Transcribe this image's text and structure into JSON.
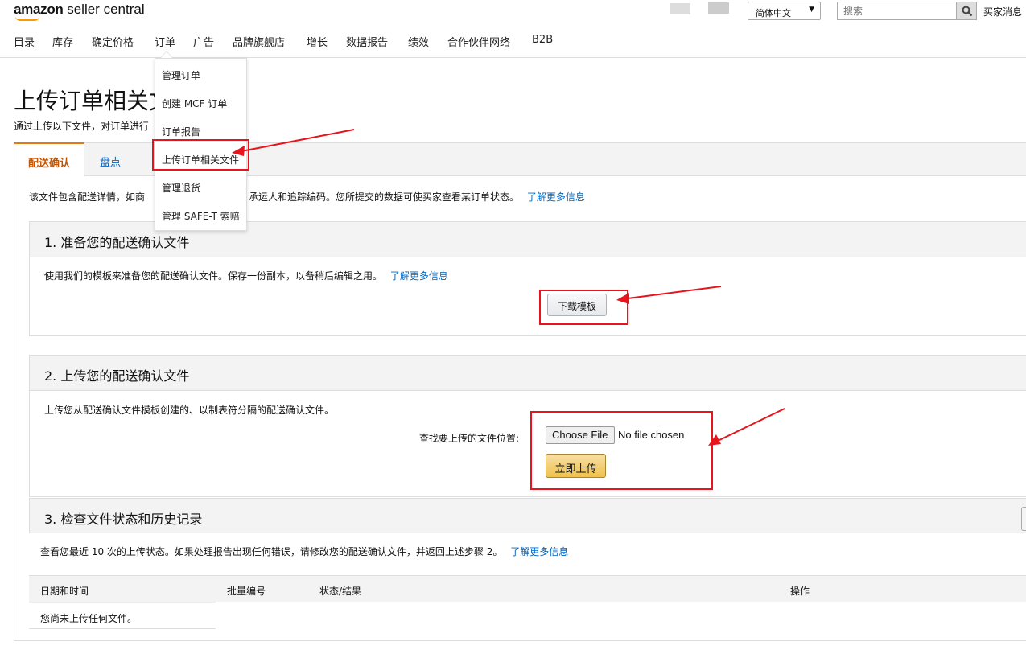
{
  "header": {
    "logo_bold": "amazon",
    "logo_light": " seller central",
    "language": "简体中文",
    "search_placeholder": "搜索",
    "buyer_messages": "买家消息 |"
  },
  "nav": {
    "items": [
      "目录",
      "库存",
      "确定价格",
      "订单",
      "广告",
      "品牌旗舰店",
      "增长",
      "数据报告",
      "绩效",
      "合作伙伴网络",
      "B2B"
    ]
  },
  "dropdown": {
    "items": [
      "管理订单",
      "创建 MCF 订单",
      "订单报告",
      "上传订单相关文件",
      "管理退货",
      "管理 SAFE-T 索赔"
    ]
  },
  "page": {
    "title": "上传订单相关文件",
    "subtitle": "通过上传以下文件，对订单进行"
  },
  "tabs": {
    "items": [
      "配送确认",
      "盘点"
    ]
  },
  "description": {
    "pre": "该文件包含配送详情，如商",
    "post": "承运人和追踪编码。您所提交的数据可使买家查看某订单状态。",
    "link": "了解更多信息"
  },
  "section1": {
    "title": "1. 准备您的配送确认文件",
    "text": "使用我们的模板来准备您的配送确认文件。保存一份副本，以备稍后编辑之用。",
    "link": "了解更多信息",
    "button": "下载模板"
  },
  "section2": {
    "title": "2. 上传您的配送确认文件",
    "text": "上传您从配送确认文件模板创建的、以制表符分隔的配送确认文件。",
    "file_label": "查找要上传的文件位置:",
    "choose_file": "Choose File",
    "no_file": "No file chosen",
    "upload_button": "立即上传"
  },
  "section3": {
    "title": "3. 检查文件状态和历史记录",
    "text": "查看您最近 10 次的上传状态。如果处理报告出现任何错误，请修改您的配送确认文件，并返回上述步骤 2。",
    "link": "了解更多信息",
    "columns": [
      "日期和时间",
      "批量编号",
      "状态/结果",
      "操作"
    ],
    "empty_row": "您尚未上传任何文件。"
  },
  "colors": {
    "annotation_red": "#e8141c",
    "active_tab": "#c45500",
    "link": "#0066c0",
    "upload_button": "#f0c14b"
  }
}
